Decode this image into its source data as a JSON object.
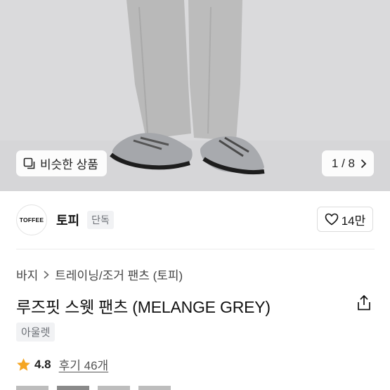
{
  "gallery": {
    "similar_label": "비슷한 상품",
    "counter": "1 / 8"
  },
  "brand": {
    "logo_text": "TOFFEE",
    "name": "토피",
    "badge": "단독",
    "like_count": "14만"
  },
  "breadcrumb": [
    "바지",
    "트레이닝/조거 팬츠 (토피)"
  ],
  "product": {
    "title": "루즈핏 스웻 팬츠 (MELANGE GREY)",
    "tag": "아울렛",
    "rating": "4.8",
    "reviews": "후기 46개"
  },
  "colors": {
    "star": "#f5a623",
    "badge_bg": "#f1f2f4"
  }
}
